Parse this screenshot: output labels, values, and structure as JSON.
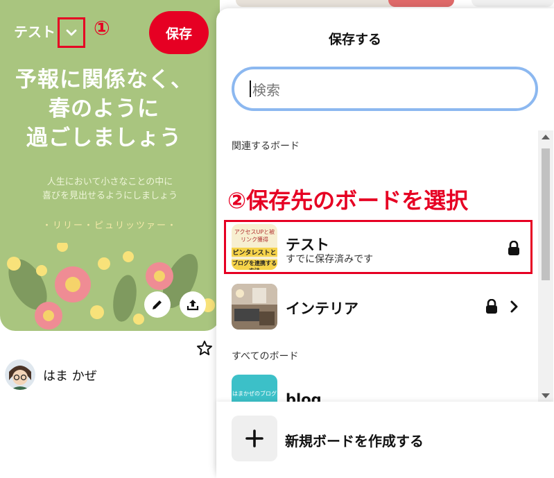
{
  "pin": {
    "board_name": "テスト",
    "save_label": "保存",
    "annotation_1": "①",
    "title_lines": [
      "予報に関係なく、",
      "春のように",
      "過ごしましょう"
    ],
    "subtitle_lines": [
      "人生において小さなことの中に",
      "喜びを見出せるようにしましょう"
    ],
    "author": "・リリー・ピュリッツァー・",
    "user_name": "はま かぜ"
  },
  "panel": {
    "title": "保存する",
    "search_placeholder": "検索",
    "related_label": "関連するボード",
    "annotation_2": "②保存先のボードを選択",
    "all_boards_label": "すべてのボード",
    "boards": [
      {
        "label": "テスト",
        "note": "すでに保存済みです",
        "thumb_lines": [
          "アクセスUPと被リンク獲得",
          "ピンタレストと",
          "ブログを連携する方法"
        ]
      },
      {
        "label": "インテリア"
      },
      {
        "label": "blog",
        "thumb_text": "はまかぜのブログ"
      }
    ],
    "create_label": "新規ボードを作成する"
  },
  "colors": {
    "accent_red": "#e60023",
    "pin_bg": "#a9c57f",
    "search_border": "#8cb8f0"
  }
}
